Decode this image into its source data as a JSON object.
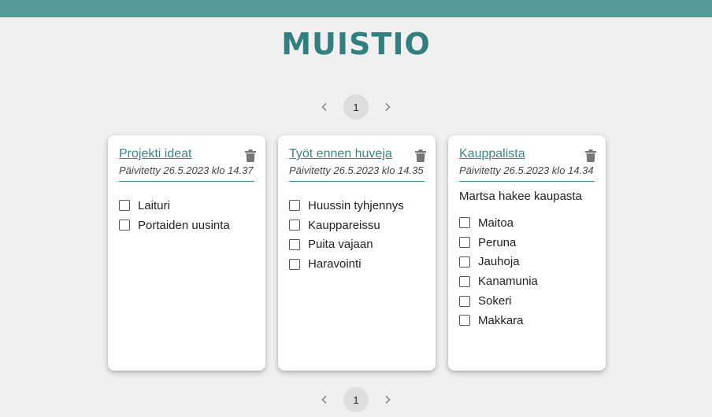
{
  "app": {
    "title": "MUISTIO"
  },
  "pagination": {
    "current_page": "1",
    "prev_icon": "chevron-left-icon",
    "next_icon": "chevron-right-icon"
  },
  "colors": {
    "accent": "#559b9a",
    "logo": "#327f80",
    "link": "#3a8587",
    "background": "#f0f0f0"
  },
  "notes": [
    {
      "title": "Projekti ideat",
      "updated": "Päivitetty 26.5.2023 klo 14.37",
      "description": "",
      "items": [
        {
          "label": "Laituri",
          "checked": false
        },
        {
          "label": "Portaiden uusinta",
          "checked": false
        }
      ]
    },
    {
      "title": "Työt ennen huveja",
      "updated": "Päivitetty 26.5.2023 klo 14.35",
      "description": "",
      "items": [
        {
          "label": "Huussin tyhjennys",
          "checked": false
        },
        {
          "label": "Kauppareissu",
          "checked": false
        },
        {
          "label": "Puita vajaan",
          "checked": false
        },
        {
          "label": "Haravointi",
          "checked": false
        }
      ]
    },
    {
      "title": "Kauppalista",
      "updated": "Päivitetty 26.5.2023 klo 14.34",
      "description": "Martsa hakee kaupasta",
      "items": [
        {
          "label": "Maitoa",
          "checked": false
        },
        {
          "label": "Peruna",
          "checked": false
        },
        {
          "label": "Jauhoja",
          "checked": false
        },
        {
          "label": "Kanamunia",
          "checked": false
        },
        {
          "label": "Sokeri",
          "checked": false
        },
        {
          "label": "Makkara",
          "checked": false
        }
      ]
    }
  ]
}
